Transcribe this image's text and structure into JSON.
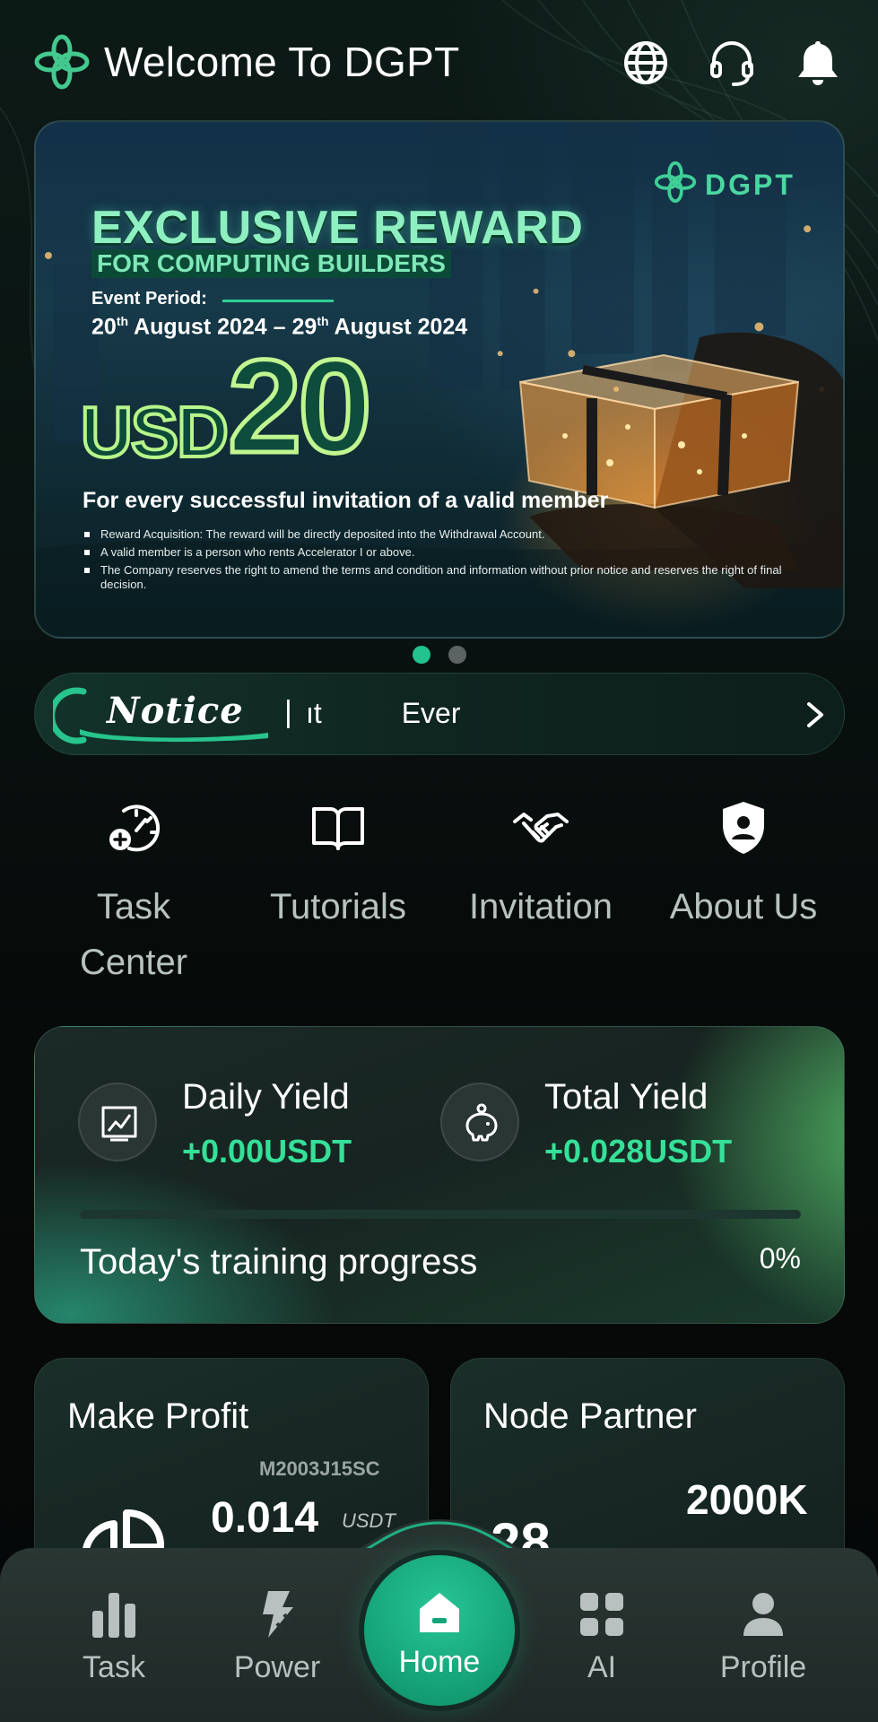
{
  "header": {
    "title": "Welcome To DGPT",
    "icons": [
      "dgpt-logo-icon",
      "globe-icon",
      "headset-icon",
      "bell-icon"
    ]
  },
  "banner": {
    "brand": "DGPT",
    "headline": "EXCLUSIVE REWARD",
    "subheadline": "FOR COMPUTING BUILDERS",
    "period_label": "Event Period:",
    "period_start_day": "20",
    "period_start_sup": "th",
    "period_start_rest": " August 2024 – 29",
    "period_end_sup": "th",
    "period_end_rest": " August 2024",
    "currency": "USD",
    "amount": "20",
    "invite_text": "For every successful invitation of a valid member",
    "terms": [
      "Reward Acquisition: The reward will be directly deposited into the Withdrawal Account.",
      "A valid member is a person who rents Accelerator I or above.",
      "The Company reserves the right to amend the terms and condition and information without prior notice and reserves the right of final decision."
    ],
    "slides_total": 2,
    "active_slide": 1
  },
  "notice": {
    "label": "Notice",
    "separator": "|",
    "marquee": "ıt          Ever"
  },
  "quick_menu": [
    {
      "label": "Task Center",
      "icon": "speedometer-plus-icon"
    },
    {
      "label": "Tutorials",
      "icon": "book-icon"
    },
    {
      "label": "Invitation",
      "icon": "handshake-icon"
    },
    {
      "label": "About Us",
      "icon": "shield-user-icon"
    }
  ],
  "yield": {
    "daily_title": "Daily Yield",
    "daily_value": "+0.00USDT",
    "total_title": "Total Yield",
    "total_value": "+0.028USDT",
    "progress_label": "Today's training progress",
    "progress_text": "0%",
    "progress_fraction": 0
  },
  "cards": {
    "profit": {
      "title": "Make Profit",
      "device": "M2003J15SC",
      "value": "0.014",
      "unit": "USDT"
    },
    "node": {
      "title": "Node Partner",
      "value": "2000K",
      "partial_value": "28"
    }
  },
  "tabbar": [
    {
      "label": "Task",
      "icon": "bar-chart-icon"
    },
    {
      "label": "Power",
      "icon": "lightning-icon"
    },
    {
      "label": "Home",
      "icon": "home-icon"
    },
    {
      "label": "AI",
      "icon": "grid-icon"
    },
    {
      "label": "Profile",
      "icon": "user-icon"
    }
  ],
  "colors": {
    "accent": "#35e098",
    "home_button": "#16a57a",
    "background": "#060a09"
  }
}
